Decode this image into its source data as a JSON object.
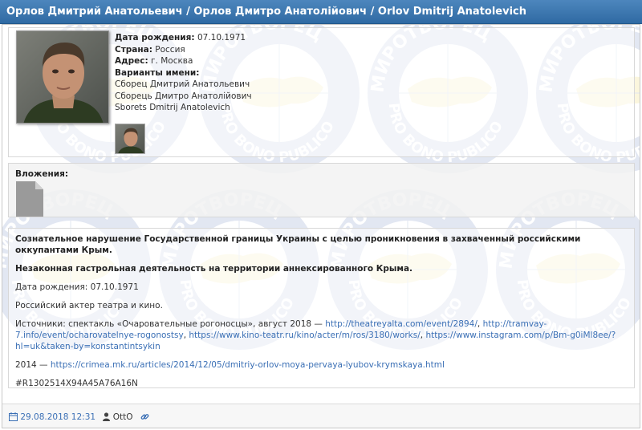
{
  "header": {
    "title": "Орлов Дмитрий Анатольевич / Орлов Дмитро Анатолійович / Orlov Dmitrij Anatolevich"
  },
  "watermark": {
    "top_text": "МИРОТВОРЕЦ",
    "bottom_text": "PRO BONO PUBLICO",
    "color": "#2b4fa0",
    "accent_color": "#e8c100"
  },
  "profile": {
    "birth_label": "Дата рождения:",
    "birth_value": "07.10.1971",
    "country_label": "Страна:",
    "country_value": "Россия",
    "address_label": "Адрес:",
    "address_value": "г. Москва",
    "variants_label": "Варианты имени:",
    "variants": [
      "Сборец Дмитрий Анатольевич",
      "Сборець Дмитро Анатолійович",
      "Sborets Dmitrij Anatolevich"
    ]
  },
  "attachments": {
    "label": "Вложения:",
    "file_icon": "file-icon"
  },
  "description": {
    "headline1": "Сознательное нарушение Государственной границы Украины с целью проникновения в захваченный российскими оккупантами Крым.",
    "headline2": "Незаконная гастрольная деятельность на территории аннексированного Крыма.",
    "birth": "Дата рождения: 07.10.1971",
    "bio": "Российский актер театра и кино.",
    "sources_prefix": "Источники: спектакль «Очаровательные рогоносцы», август 2018 — ",
    "link1": "http://theatreyalta.com/event/2894/",
    "sep1": ", ",
    "link2": "http://tramvay-7.info/event/ocharovatelnye-rogonostsy",
    "sep2": ", ",
    "link3": "https://www.kino-teatr.ru/kino/acter/m/ros/3180/works/",
    "sep3": ", ",
    "link4": "https://www.instagram.com/p/Bm-g0iMl8ee/?hl=uk&taken-by=konstantintsykin",
    "line2014_prefix": "2014 — ",
    "link5": "https://crimea.mk.ru/articles/2014/12/05/dmitriy-orlov-moya-pervaya-lyubov-krymskaya.html",
    "hash": "#R1302514X94A45A76A16N"
  },
  "footer": {
    "date_icon": "calendar-icon",
    "date": "29.08.2018 12:31",
    "user_icon": "user-icon",
    "user": "OttO",
    "link_icon": "link-icon",
    "link_color": "#3a6fb5"
  }
}
